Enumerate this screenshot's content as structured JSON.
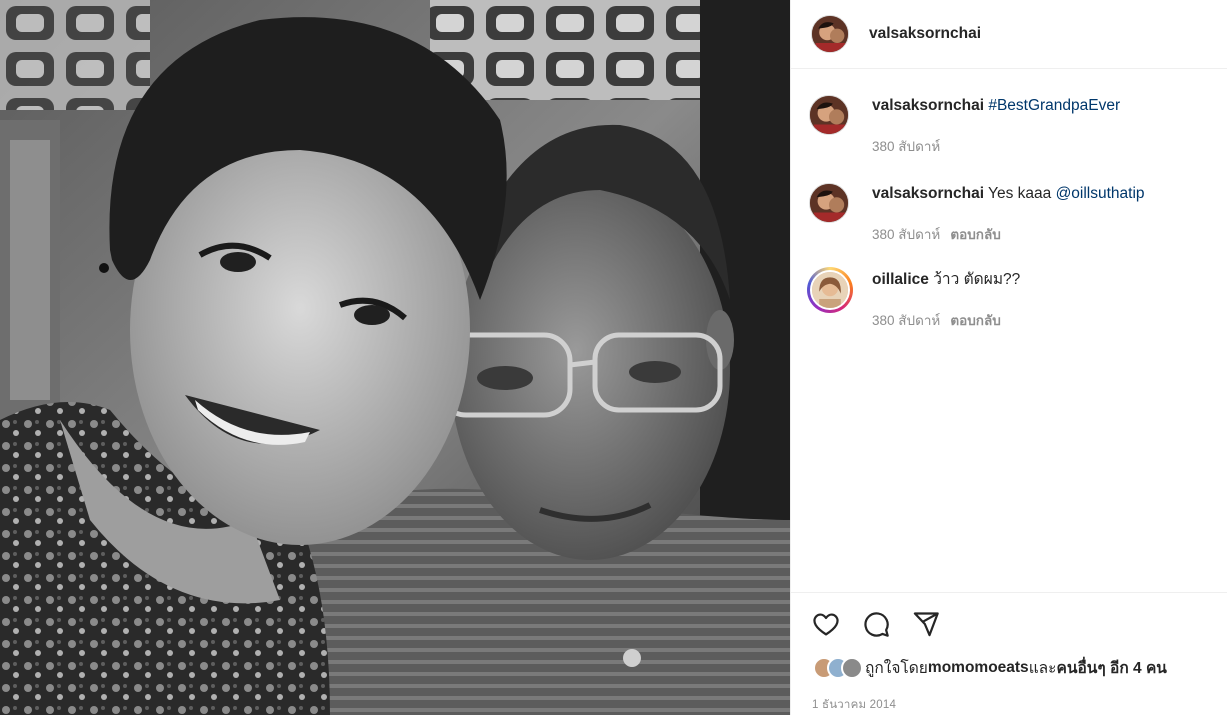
{
  "post": {
    "owner_username": "valsaksornchai"
  },
  "comments": [
    {
      "author": "valsaksornchai",
      "body": "",
      "tag": "#BestGrandpaEver",
      "time": "380 สัปดาห์",
      "reply_label": ""
    },
    {
      "author": "valsaksornchai",
      "body": "Yes kaaa ",
      "tag": "@oillsuthatip",
      "time": "380 สัปดาห์",
      "reply_label": "ตอบกลับ"
    },
    {
      "author": "oillalice",
      "body": "ว้าว ตัดผม??",
      "tag": "",
      "time": "380 สัปดาห์",
      "reply_label": "ตอบกลับ"
    }
  ],
  "actions": {
    "like_icon": "heart-icon",
    "comment_icon": "comment-icon",
    "share_icon": "share-icon"
  },
  "likes": {
    "prefix": "ถูกใจโดย ",
    "first_liker": "momomoeats",
    "connector": " และ ",
    "others": "คนอื่นๆ อีก 4 คน"
  },
  "date": "1 ธันวาคม 2014",
  "colors": {
    "link": "#00376b",
    "muted": "#8e8e8e",
    "text": "#262626",
    "border": "#efefef"
  }
}
